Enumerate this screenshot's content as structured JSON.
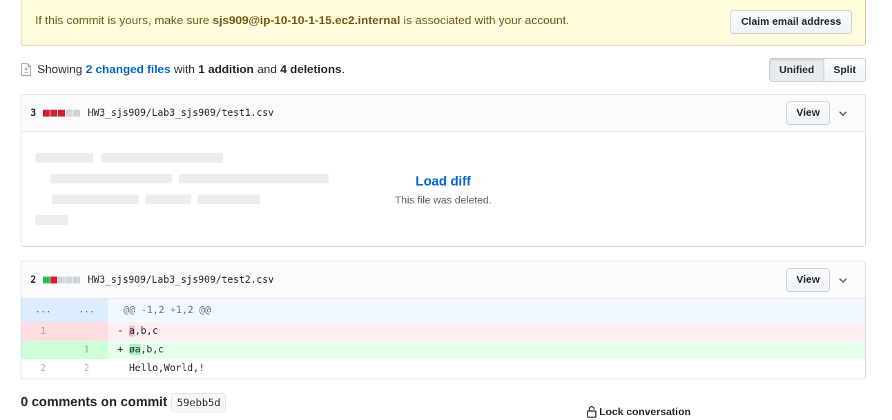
{
  "flash": {
    "prefix": "If this commit is yours, make sure",
    "email": "sjs909@ip-10-10-1-15.ec2.internal",
    "suffix": "is associated with your account.",
    "claim_button": "Claim email address"
  },
  "summary": {
    "showing": "Showing",
    "changed_files_link": "2 changed files",
    "with": "with",
    "additions": "1 addition",
    "and": "and",
    "deletions": "4 deletions",
    "period": "."
  },
  "view_toggle": {
    "unified": "Unified",
    "split": "Split",
    "selected": "Unified"
  },
  "files": [
    {
      "count": "3",
      "diffstat": [
        "del",
        "del",
        "del",
        "neu",
        "neu"
      ],
      "path": "HW3_sjs909/Lab3_sjs909/test1.csv",
      "view_button": "View",
      "load_diff": "Load diff",
      "note": "This file was deleted."
    },
    {
      "count": "2",
      "diffstat": [
        "add",
        "del",
        "neu",
        "neu",
        "neu"
      ],
      "path": "HW3_sjs909/Lab3_sjs909/test2.csv",
      "view_button": "View",
      "hunk": {
        "left": "...",
        "right": "...",
        "header": "@@ -1,2 +1,2 @@"
      },
      "lines": [
        {
          "type": "del",
          "old": "1",
          "new": "",
          "marker": "-",
          "highlight": "a",
          "rest": ",b,c"
        },
        {
          "type": "add",
          "old": "",
          "new": "1",
          "marker": "+",
          "highlight": "øa",
          "rest": ",b,c"
        },
        {
          "type": "ctx",
          "old": "2",
          "new": "2",
          "marker": " ",
          "highlight": "",
          "rest": "Hello,World,!"
        }
      ]
    }
  ],
  "comments": {
    "heading": "0 comments on commit",
    "sha": "59ebb5d",
    "lock_label": "Lock conversation"
  },
  "colors": {
    "link": "#0366d6",
    "flash_bg": "#fffbdd",
    "deletion": "#cb2431",
    "addition": "#2cbe4e"
  }
}
